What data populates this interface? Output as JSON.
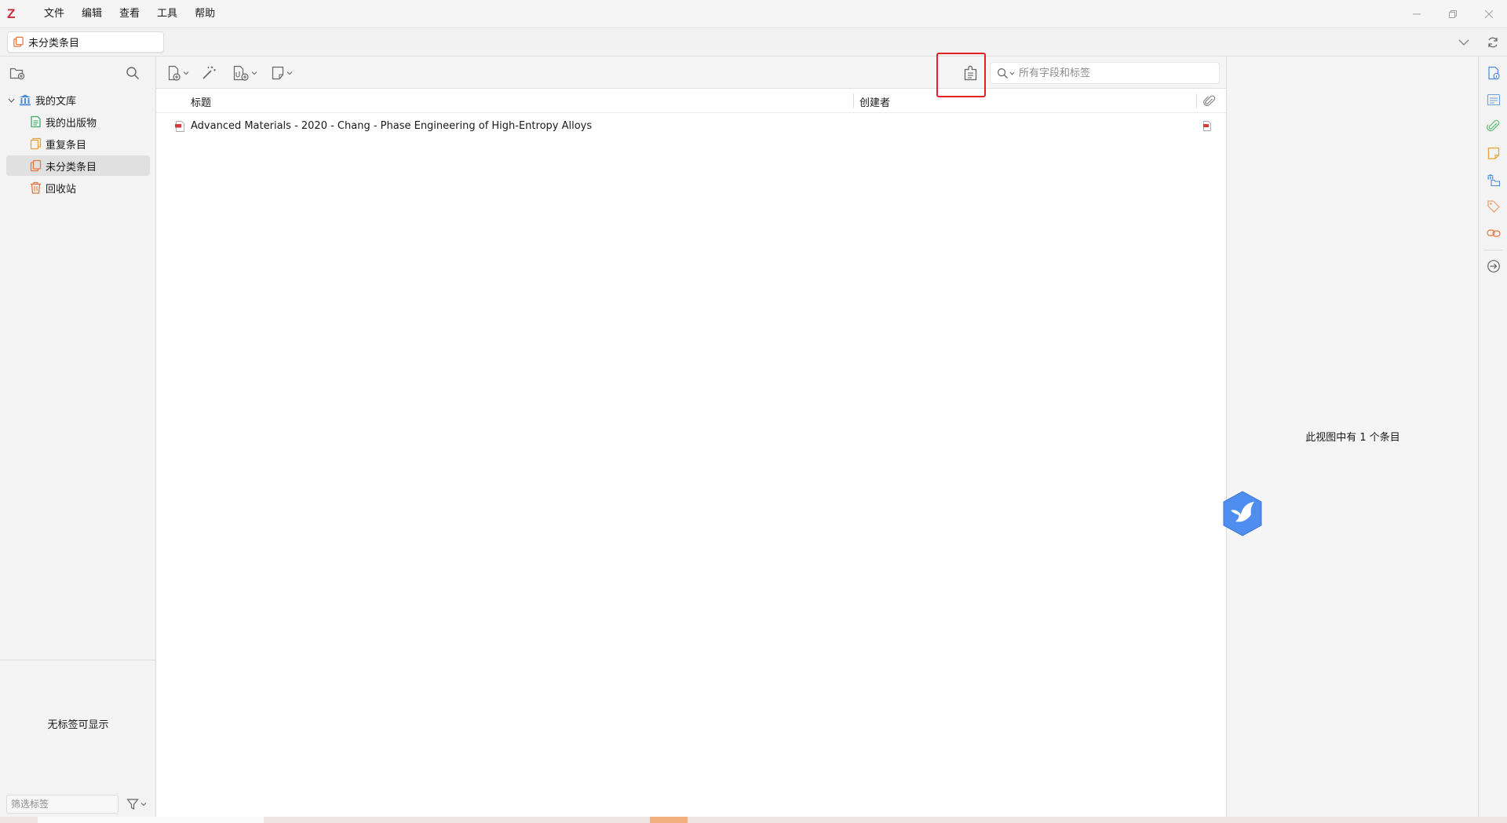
{
  "app": {
    "logo_letter": "Z"
  },
  "menubar": {
    "items": [
      "文件",
      "编辑",
      "查看",
      "工具",
      "帮助"
    ]
  },
  "tab": {
    "label": "未分类条目"
  },
  "collections": {
    "library": "我的文库",
    "items": [
      {
        "label": "我的出版物",
        "icon": "publications-icon",
        "color": "#3fae6a"
      },
      {
        "label": "重复条目",
        "icon": "duplicates-icon",
        "color": "#e8a33d"
      },
      {
        "label": "未分类条目",
        "icon": "unfiled-icon",
        "color": "#e8743d"
      },
      {
        "label": "回收站",
        "icon": "trash-icon",
        "color": "#e8743d"
      }
    ]
  },
  "tags": {
    "empty_message": "无标签可显示",
    "filter_placeholder": "筛选标签"
  },
  "search": {
    "placeholder": "所有字段和标签"
  },
  "columns": {
    "title": "标题",
    "creator": "创建者"
  },
  "items": [
    {
      "title": "Advanced Materials - 2020 - Chang - Phase Engineering of High-Entropy Alloys",
      "creator": "",
      "attachment": "pdf"
    }
  ],
  "item_pane": {
    "count_text": "此视图中有 1 个条目"
  },
  "colors": {
    "accent": "#cc2936",
    "highlight": "#e42121",
    "selected_row": "#e0e0e0",
    "sidenav_blue": "#4a8ad8"
  }
}
